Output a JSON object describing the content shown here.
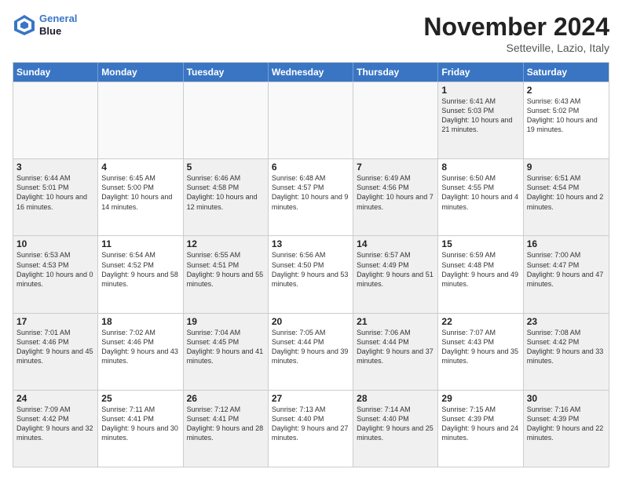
{
  "header": {
    "logo_line1": "General",
    "logo_line2": "Blue",
    "month_title": "November 2024",
    "subtitle": "Setteville, Lazio, Italy"
  },
  "weekdays": [
    "Sunday",
    "Monday",
    "Tuesday",
    "Wednesday",
    "Thursday",
    "Friday",
    "Saturday"
  ],
  "rows": [
    [
      {
        "day": "",
        "text": "",
        "empty": true
      },
      {
        "day": "",
        "text": "",
        "empty": true
      },
      {
        "day": "",
        "text": "",
        "empty": true
      },
      {
        "day": "",
        "text": "",
        "empty": true
      },
      {
        "day": "",
        "text": "",
        "empty": true
      },
      {
        "day": "1",
        "text": "Sunrise: 6:41 AM\nSunset: 5:03 PM\nDaylight: 10 hours and 21 minutes.",
        "shaded": true
      },
      {
        "day": "2",
        "text": "Sunrise: 6:43 AM\nSunset: 5:02 PM\nDaylight: 10 hours and 19 minutes.",
        "shaded": false
      }
    ],
    [
      {
        "day": "3",
        "text": "Sunrise: 6:44 AM\nSunset: 5:01 PM\nDaylight: 10 hours and 16 minutes.",
        "shaded": true
      },
      {
        "day": "4",
        "text": "Sunrise: 6:45 AM\nSunset: 5:00 PM\nDaylight: 10 hours and 14 minutes.",
        "shaded": false
      },
      {
        "day": "5",
        "text": "Sunrise: 6:46 AM\nSunset: 4:58 PM\nDaylight: 10 hours and 12 minutes.",
        "shaded": true
      },
      {
        "day": "6",
        "text": "Sunrise: 6:48 AM\nSunset: 4:57 PM\nDaylight: 10 hours and 9 minutes.",
        "shaded": false
      },
      {
        "day": "7",
        "text": "Sunrise: 6:49 AM\nSunset: 4:56 PM\nDaylight: 10 hours and 7 minutes.",
        "shaded": true
      },
      {
        "day": "8",
        "text": "Sunrise: 6:50 AM\nSunset: 4:55 PM\nDaylight: 10 hours and 4 minutes.",
        "shaded": false
      },
      {
        "day": "9",
        "text": "Sunrise: 6:51 AM\nSunset: 4:54 PM\nDaylight: 10 hours and 2 minutes.",
        "shaded": true
      }
    ],
    [
      {
        "day": "10",
        "text": "Sunrise: 6:53 AM\nSunset: 4:53 PM\nDaylight: 10 hours and 0 minutes.",
        "shaded": true
      },
      {
        "day": "11",
        "text": "Sunrise: 6:54 AM\nSunset: 4:52 PM\nDaylight: 9 hours and 58 minutes.",
        "shaded": false
      },
      {
        "day": "12",
        "text": "Sunrise: 6:55 AM\nSunset: 4:51 PM\nDaylight: 9 hours and 55 minutes.",
        "shaded": true
      },
      {
        "day": "13",
        "text": "Sunrise: 6:56 AM\nSunset: 4:50 PM\nDaylight: 9 hours and 53 minutes.",
        "shaded": false
      },
      {
        "day": "14",
        "text": "Sunrise: 6:57 AM\nSunset: 4:49 PM\nDaylight: 9 hours and 51 minutes.",
        "shaded": true
      },
      {
        "day": "15",
        "text": "Sunrise: 6:59 AM\nSunset: 4:48 PM\nDaylight: 9 hours and 49 minutes.",
        "shaded": false
      },
      {
        "day": "16",
        "text": "Sunrise: 7:00 AM\nSunset: 4:47 PM\nDaylight: 9 hours and 47 minutes.",
        "shaded": true
      }
    ],
    [
      {
        "day": "17",
        "text": "Sunrise: 7:01 AM\nSunset: 4:46 PM\nDaylight: 9 hours and 45 minutes.",
        "shaded": true
      },
      {
        "day": "18",
        "text": "Sunrise: 7:02 AM\nSunset: 4:46 PM\nDaylight: 9 hours and 43 minutes.",
        "shaded": false
      },
      {
        "day": "19",
        "text": "Sunrise: 7:04 AM\nSunset: 4:45 PM\nDaylight: 9 hours and 41 minutes.",
        "shaded": true
      },
      {
        "day": "20",
        "text": "Sunrise: 7:05 AM\nSunset: 4:44 PM\nDaylight: 9 hours and 39 minutes.",
        "shaded": false
      },
      {
        "day": "21",
        "text": "Sunrise: 7:06 AM\nSunset: 4:44 PM\nDaylight: 9 hours and 37 minutes.",
        "shaded": true
      },
      {
        "day": "22",
        "text": "Sunrise: 7:07 AM\nSunset: 4:43 PM\nDaylight: 9 hours and 35 minutes.",
        "shaded": false
      },
      {
        "day": "23",
        "text": "Sunrise: 7:08 AM\nSunset: 4:42 PM\nDaylight: 9 hours and 33 minutes.",
        "shaded": true
      }
    ],
    [
      {
        "day": "24",
        "text": "Sunrise: 7:09 AM\nSunset: 4:42 PM\nDaylight: 9 hours and 32 minutes.",
        "shaded": true
      },
      {
        "day": "25",
        "text": "Sunrise: 7:11 AM\nSunset: 4:41 PM\nDaylight: 9 hours and 30 minutes.",
        "shaded": false
      },
      {
        "day": "26",
        "text": "Sunrise: 7:12 AM\nSunset: 4:41 PM\nDaylight: 9 hours and 28 minutes.",
        "shaded": true
      },
      {
        "day": "27",
        "text": "Sunrise: 7:13 AM\nSunset: 4:40 PM\nDaylight: 9 hours and 27 minutes.",
        "shaded": false
      },
      {
        "day": "28",
        "text": "Sunrise: 7:14 AM\nSunset: 4:40 PM\nDaylight: 9 hours and 25 minutes.",
        "shaded": true
      },
      {
        "day": "29",
        "text": "Sunrise: 7:15 AM\nSunset: 4:39 PM\nDaylight: 9 hours and 24 minutes.",
        "shaded": false
      },
      {
        "day": "30",
        "text": "Sunrise: 7:16 AM\nSunset: 4:39 PM\nDaylight: 9 hours and 22 minutes.",
        "shaded": true
      }
    ]
  ]
}
